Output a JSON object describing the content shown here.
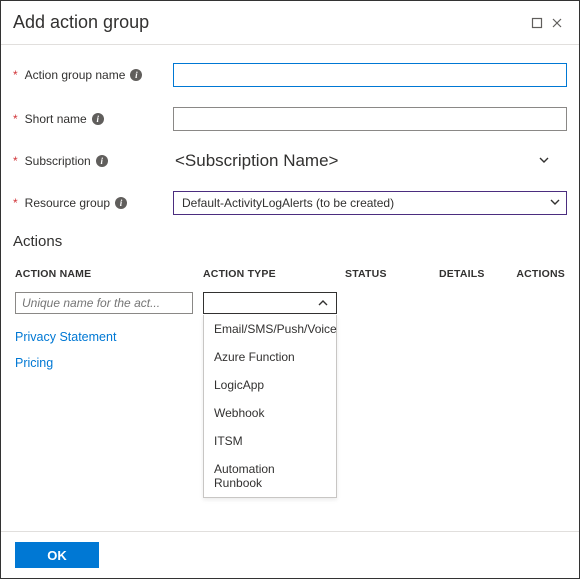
{
  "header": {
    "title": "Add action group"
  },
  "form": {
    "group_name": {
      "label": "Action group name",
      "value": ""
    },
    "short_name": {
      "label": "Short name",
      "value": ""
    },
    "subscription": {
      "label": "Subscription",
      "value": "<Subscription Name>"
    },
    "resource_group": {
      "label": "Resource group",
      "selected": "Default-ActivityLogAlerts (to be created)"
    }
  },
  "actions": {
    "heading": "Actions",
    "columns": {
      "name": "ACTION NAME",
      "type": "ACTION TYPE",
      "status": "STATUS",
      "details": "DETAILS",
      "actions": "ACTIONS"
    },
    "row": {
      "name_placeholder": "Unique name for the act...",
      "type_options": [
        "Email/SMS/Push/Voice",
        "Azure Function",
        "LogicApp",
        "Webhook",
        "ITSM",
        "Automation Runbook"
      ]
    }
  },
  "links": {
    "privacy": "Privacy Statement",
    "pricing": "Pricing"
  },
  "footer": {
    "ok": "OK"
  }
}
